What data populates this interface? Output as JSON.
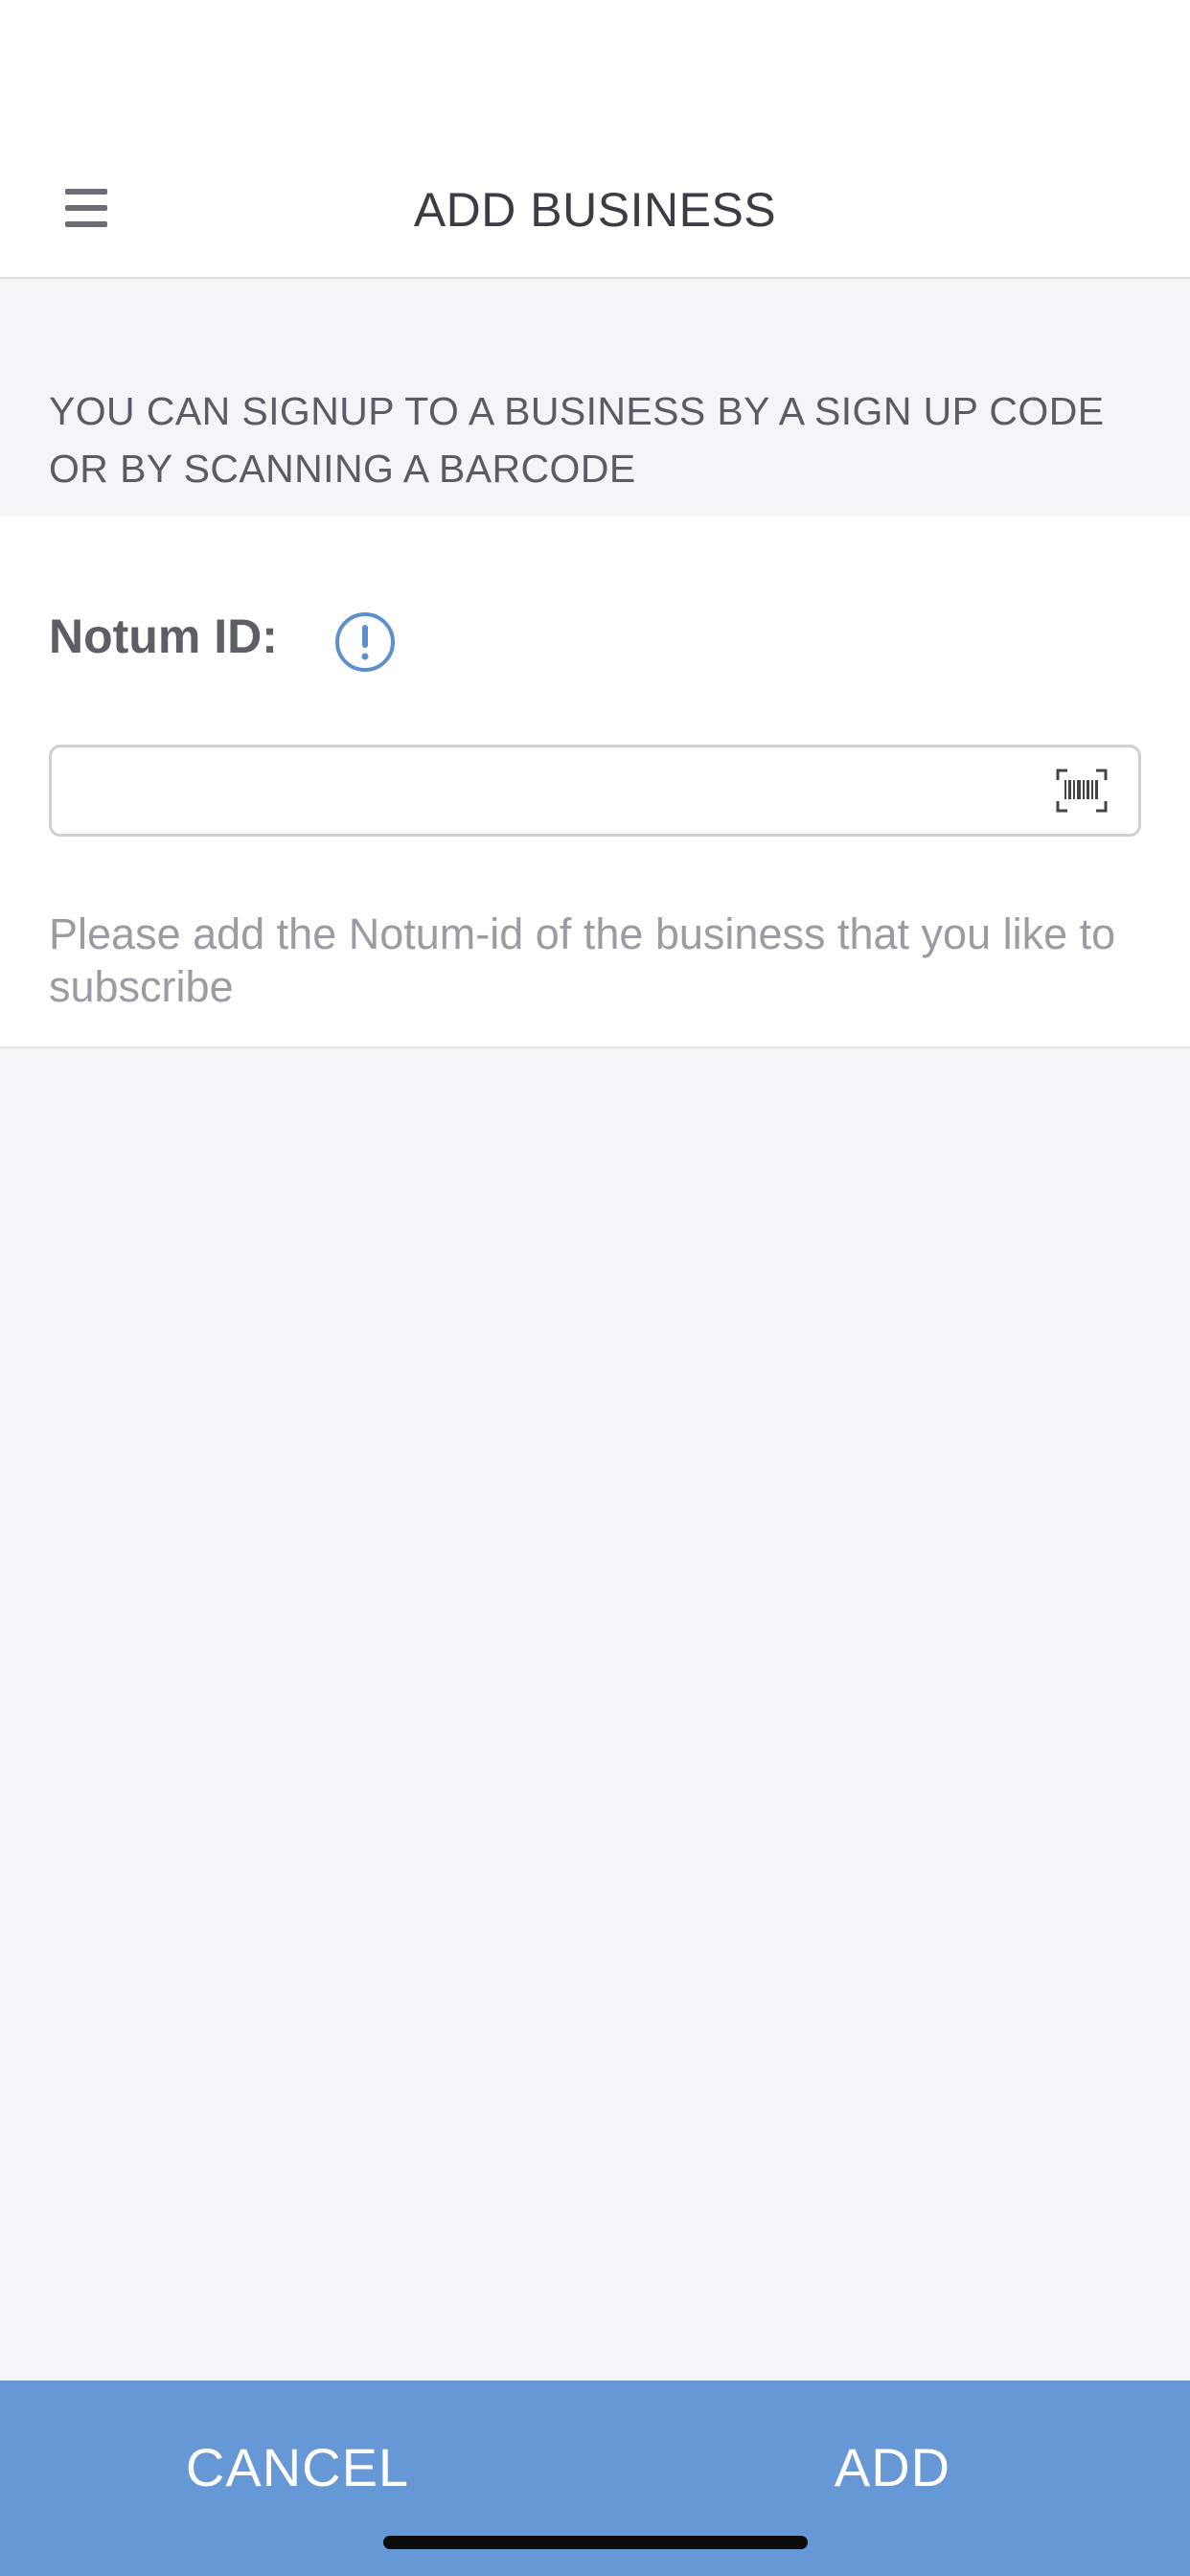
{
  "header": {
    "title": "ADD BUSINESS",
    "menu_icon": "hamburger-menu-icon"
  },
  "info_banner": {
    "text": "YOU CAN SIGNUP TO A BUSINESS BY A SIGN UP CODE OR BY SCANNING A BARCODE"
  },
  "form": {
    "label": "Notum ID:",
    "info_icon": "exclamation-circle-icon",
    "input_value": "",
    "input_placeholder": "",
    "scan_icon": "barcode-scan-icon",
    "helper": "Please add the Notum-id of the business that you like to subscribe"
  },
  "footer": {
    "cancel_label": "CANCEL",
    "add_label": "ADD"
  },
  "colors": {
    "accent": "#6598d4",
    "info_icon": "#5b8fce",
    "background": "#f4f5f9"
  }
}
